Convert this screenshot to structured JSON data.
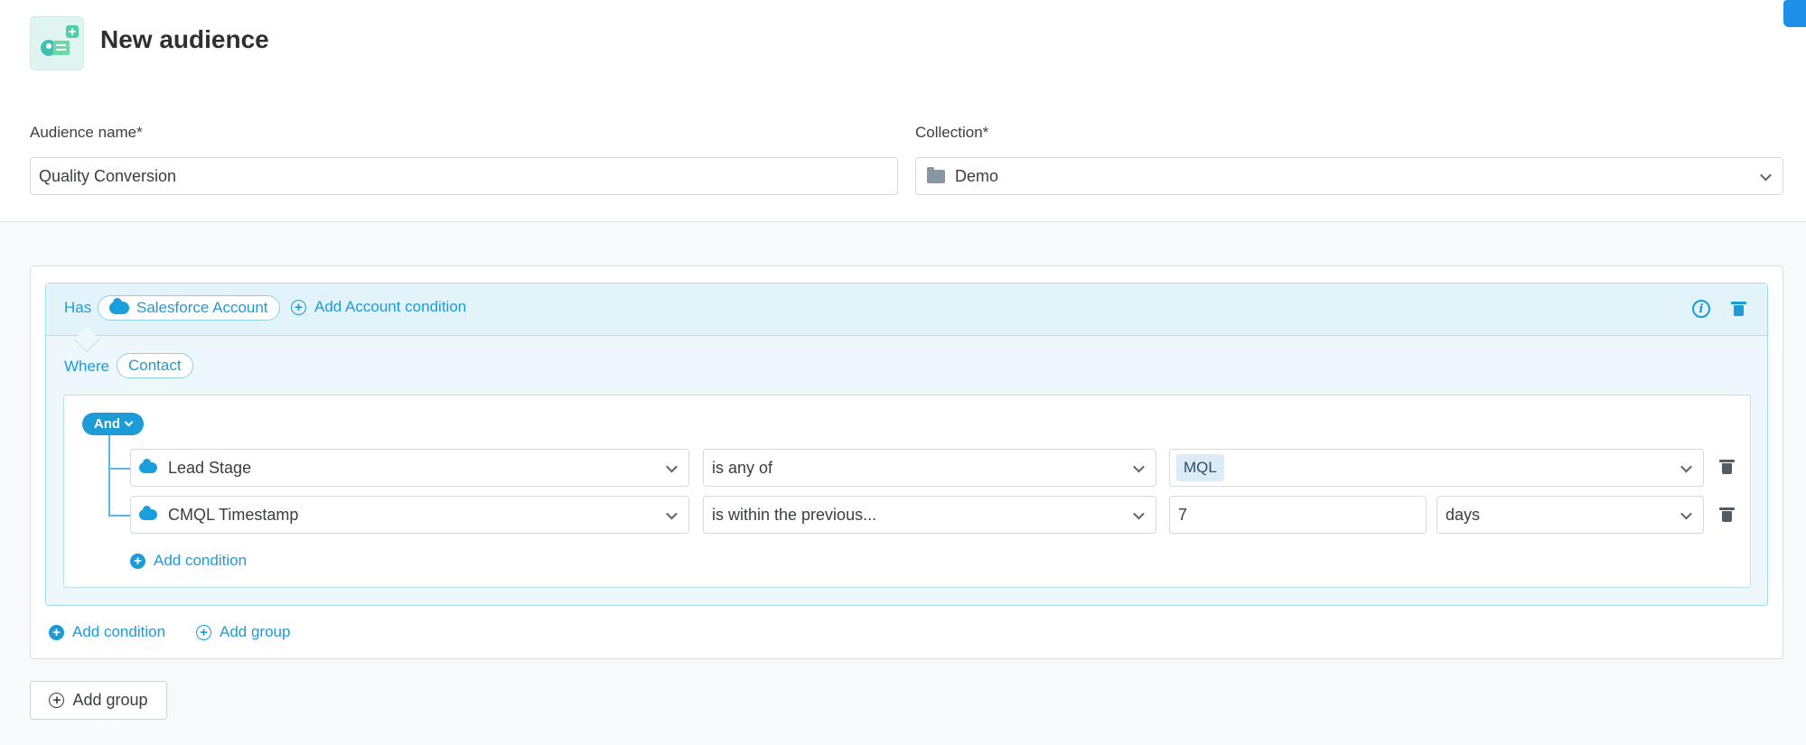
{
  "page": {
    "title": "New audience"
  },
  "form": {
    "audience_name_label": "Audience name*",
    "audience_name_value": "Quality Conversion",
    "collection_label": "Collection*",
    "collection_value": "Demo"
  },
  "group": {
    "has_label": "Has",
    "object_label": "Salesforce Account",
    "add_account_condition": "Add Account condition",
    "where_label": "Where",
    "where_object": "Contact",
    "operator": "And",
    "conditions": [
      {
        "field": "Lead Stage",
        "operator": "is any of",
        "value": "MQL"
      },
      {
        "field": "CMQL Timestamp",
        "operator": "is within the previous...",
        "value": "7",
        "unit": "days"
      }
    ],
    "add_condition_inner": "Add condition",
    "add_condition_outer": "Add condition",
    "add_group_inner": "Add group"
  },
  "footer": {
    "add_group": "Add group"
  },
  "colors": {
    "accent": "#1d9bd7",
    "group_bg": "#eef8fc"
  }
}
